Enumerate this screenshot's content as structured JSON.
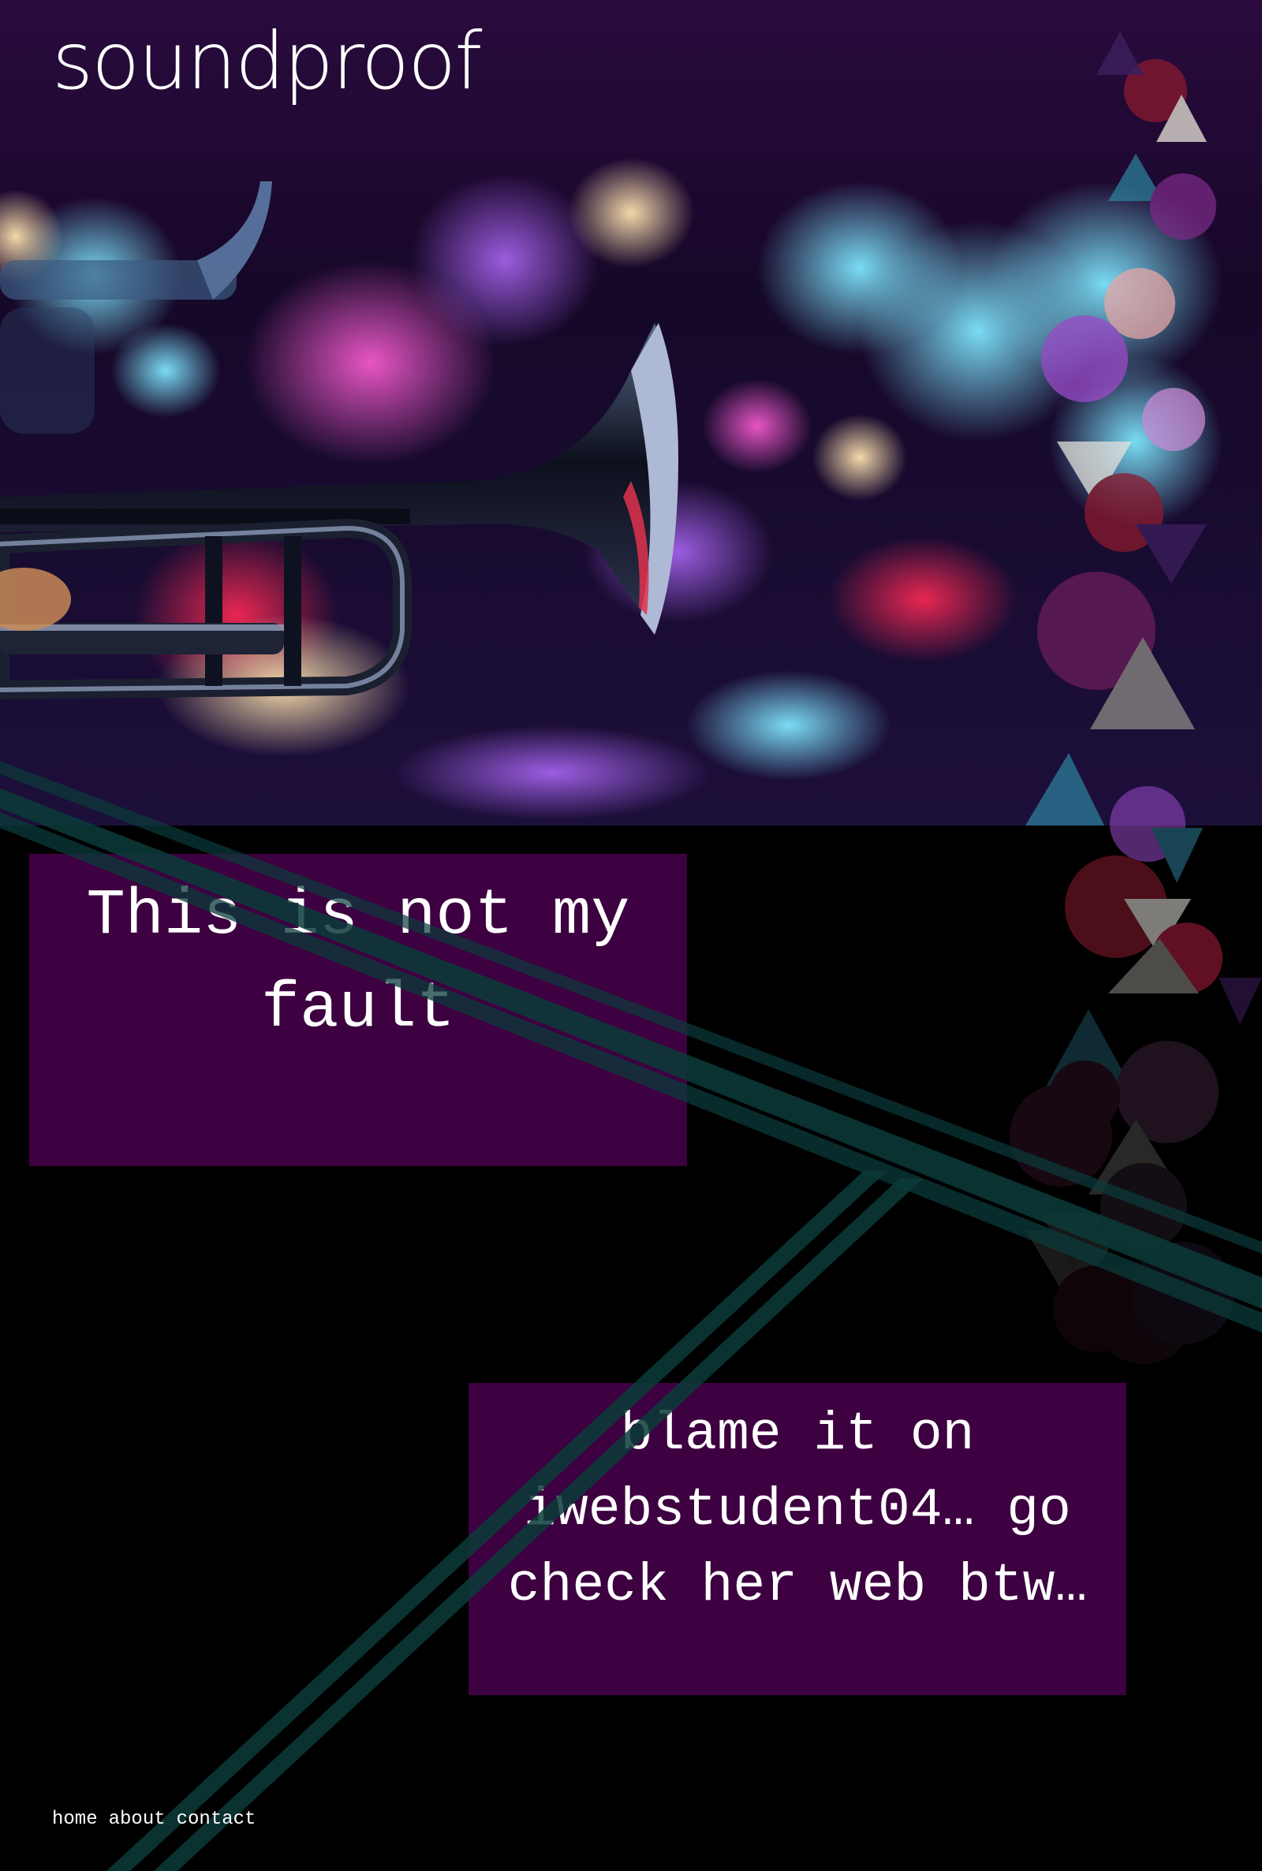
{
  "site": {
    "logo": "soundproof"
  },
  "hero": {
    "image_subject": "trumpet-on-stage-with-bokeh-lights"
  },
  "cards": {
    "first": "This is not my fault",
    "second": "blame it on iwebstudent04… go check her web btw…"
  },
  "nav": {
    "home": "home",
    "about": "about",
    "contact": "contact"
  },
  "colors": {
    "card_bg": "#3d0040",
    "page_bg": "#000000",
    "stripe": "#0b3b3a",
    "accent_purple": "#7a2a86",
    "accent_red": "#8a1a2e",
    "accent_teal": "#2c7d9a"
  }
}
